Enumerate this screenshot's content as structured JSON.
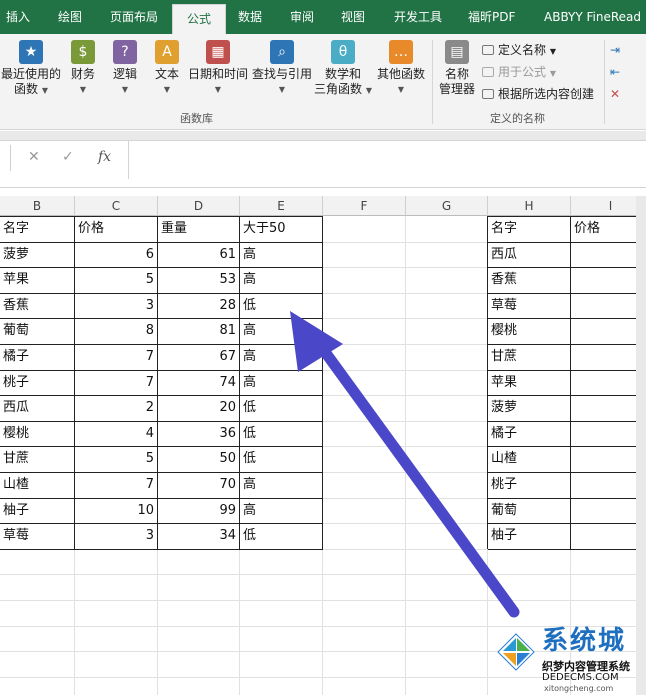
{
  "ribbon_tabs": [
    "插入",
    "绘图",
    "页面布局",
    "公式",
    "数据",
    "审阅",
    "视图",
    "开发工具",
    "福昕PDF",
    "ABBYY FineRead"
  ],
  "active_tab": "公式",
  "function_library": {
    "buttons": [
      {
        "label1": "最近使用的",
        "label2": "函数",
        "icon": "star-icon",
        "color": "#2e75b6"
      },
      {
        "label1": "财务",
        "label2": "",
        "icon": "coins-icon",
        "color": "#7a9a3a"
      },
      {
        "label1": "逻辑",
        "label2": "",
        "icon": "question-icon",
        "color": "#8064a2"
      },
      {
        "label1": "文本",
        "label2": "",
        "icon": "text-a-icon",
        "color": "#e0a030"
      },
      {
        "label1": "日期和时间",
        "label2": "",
        "icon": "calendar-icon",
        "color": "#c0504d"
      },
      {
        "label1": "查找与引用",
        "label2": "",
        "icon": "magnifier-icon",
        "color": "#2e75b6"
      },
      {
        "label1": "数学和",
        "label2": "三角函数",
        "icon": "theta-icon",
        "color": "#4bacc6"
      },
      {
        "label1": "其他函数",
        "label2": "",
        "icon": "more-functions-icon",
        "color": "#e88a2a"
      }
    ],
    "group_label": "函数库"
  },
  "defined_names": {
    "name_manager_l1": "名称",
    "name_manager_l2": "管理器",
    "define_name": "定义名称",
    "use_in_formula": "用于公式",
    "create_from_selection": "根据所选内容创建",
    "group_label": "定义的名称"
  },
  "formula_bar": {
    "cancel_glyph": "✕",
    "enter_glyph": "✓",
    "fx_glyph": "fx",
    "value": ""
  },
  "columns": [
    "B",
    "C",
    "D",
    "E",
    "F",
    "G",
    "H",
    "I"
  ],
  "main_table": {
    "headers": [
      "名字",
      "价格",
      "重量",
      "大于50"
    ],
    "rows": [
      [
        "菠萝",
        "6",
        "61",
        "高"
      ],
      [
        "苹果",
        "5",
        "53",
        "高"
      ],
      [
        "香蕉",
        "3",
        "28",
        "低"
      ],
      [
        "葡萄",
        "8",
        "81",
        "高"
      ],
      [
        "橘子",
        "7",
        "67",
        "高"
      ],
      [
        "桃子",
        "7",
        "74",
        "高"
      ],
      [
        "西瓜",
        "2",
        "20",
        "低"
      ],
      [
        "樱桃",
        "4",
        "36",
        "低"
      ],
      [
        "甘蔗",
        "5",
        "50",
        "低"
      ],
      [
        "山楂",
        "7",
        "70",
        "高"
      ],
      [
        "柚子",
        "10",
        "99",
        "高"
      ],
      [
        "草莓",
        "3",
        "34",
        "低"
      ]
    ]
  },
  "side_table": {
    "headers": [
      "名字",
      "价格"
    ],
    "rows": [
      "西瓜",
      "香蕉",
      "草莓",
      "樱桃",
      "甘蔗",
      "苹果",
      "菠萝",
      "橘子",
      "山楂",
      "桃子",
      "葡萄",
      "柚子"
    ]
  },
  "annotation_arrow_color": "#4a47c8",
  "watermark": {
    "big": "系统城",
    "cn": "织梦内容管理系统",
    "url": "DEDECMS.COM",
    "url2": "xitongcheng.com"
  }
}
